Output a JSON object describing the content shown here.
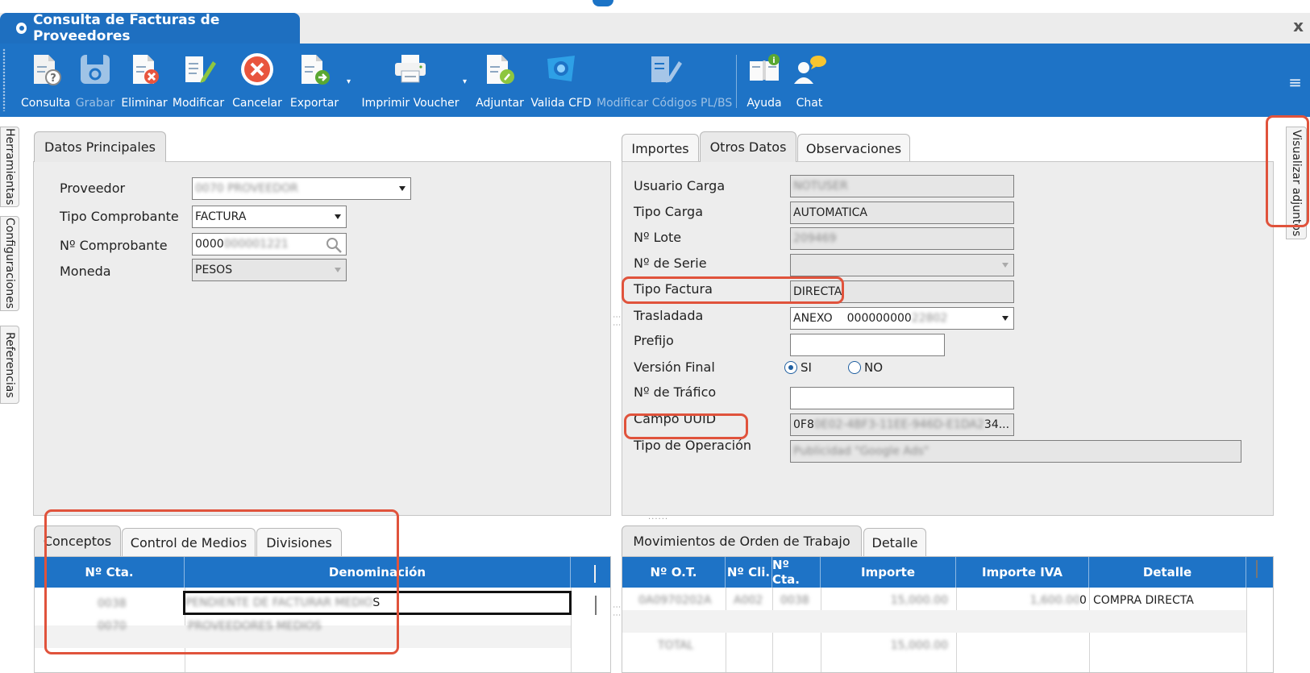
{
  "window": {
    "title": "Consulta de Facturas de Proveedores",
    "close": "x"
  },
  "toolbar": {
    "consulta": "Consulta",
    "grabar": "Grabar",
    "eliminar": "Eliminar",
    "modificar": "Modificar",
    "cancelar": "Cancelar",
    "exportar": "Exportar",
    "imprimir": "Imprimir Voucher",
    "adjuntar": "Adjuntar",
    "valida": "Valida CFD",
    "modificar_codigos": "Modificar Códigos PL/BS",
    "ayuda": "Ayuda",
    "chat": "Chat",
    "menu": "≡"
  },
  "side_tabs": {
    "herramientas": "Herramientas",
    "configuraciones": "Configuraciones",
    "referencias": "Referencias",
    "visualizar": "Visualizar adjuntos"
  },
  "datos_principales": {
    "tab": "Datos Principales",
    "proveedor_label": "Proveedor",
    "proveedor_value": "0070 PROVEEDOR",
    "tipo_label": "Tipo Comprobante",
    "tipo_value": "FACTURA",
    "numero_label": "Nº Comprobante",
    "numero_value": "0000",
    "numero_value_blur": "000001221",
    "moneda_label": "Moneda",
    "moneda_value": "PESOS"
  },
  "right_tabs": {
    "importes": "Importes",
    "otros": "Otros Datos",
    "observaciones": "Observaciones"
  },
  "otros_datos": {
    "usuario_carga_label": "Usuario Carga",
    "usuario_carga_value": "NOTUSER",
    "tipo_carga_label": "Tipo Carga",
    "tipo_carga_value": "AUTOMATICA",
    "lote_label": "Nº Lote",
    "lote_value": "209469",
    "serie_label": "Nº de Serie",
    "serie_value": "",
    "tipo_factura_label": "Tipo Factura",
    "tipo_factura_value": "DIRECTA",
    "trasladada_label": "Trasladada",
    "trasladada_prefix": "ANEXO",
    "trasladada_value": "000000000",
    "trasladada_blur": "22802",
    "prefijo_label": "Prefijo",
    "prefijo_value": "",
    "version_label": "Versión Final",
    "version_si": "SI",
    "version_no": "NO",
    "trafico_label": "Nº de Tráfico",
    "trafico_value": "",
    "uuid_label": "Campo UUID",
    "uuid_start": "0F8",
    "uuid_blur": "0E02-4BF3-11EE-946D-E1DA2",
    "uuid_end": "34...",
    "operacion_label": "Tipo de Operación",
    "operacion_value": "Publicidad \"Google Ads\""
  },
  "bottom_left_tabs": {
    "conceptos": "Conceptos",
    "control": "Control de Medios",
    "divisiones": "Divisiones"
  },
  "conceptos_grid": {
    "headers": [
      "Nº Cta.",
      "Denominación"
    ],
    "rows": [
      {
        "cta": "0038",
        "den": "PENDIENTE DE FACTURAR MEDIO",
        "den_end": "S"
      },
      {
        "cta": "0070",
        "den": "PROVEEDORES MEDIOS"
      }
    ]
  },
  "bottom_right_tabs": {
    "movimientos": "Movimientos de Orden de Trabajo",
    "detalle": "Detalle"
  },
  "movimientos_grid": {
    "headers": [
      "Nº O.T.",
      "Nº Cli.",
      "Nº Cta.",
      "Importe",
      "Importe IVA",
      "Detalle"
    ],
    "rows": [
      {
        "ot": "0A0970202A",
        "cli": "A002",
        "cta": "0038",
        "importe": "15,000.00",
        "iva": "1,600.00",
        "iva_end": "0",
        "detalle": "COMPRA DIRECTA"
      },
      {
        "ot": "TOTAL",
        "cli": "",
        "cta": "",
        "importe": "15,000.00",
        "iva": "",
        "detalle": ""
      }
    ]
  }
}
